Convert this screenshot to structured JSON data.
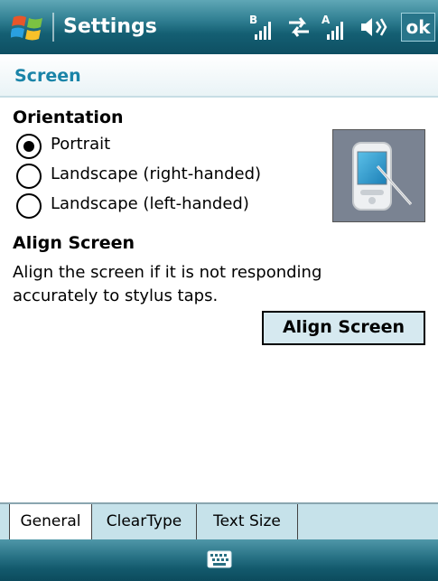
{
  "titlebar": {
    "title": "Settings",
    "ok_label": "ok",
    "status_icons": [
      "bluetooth-signal-icon",
      "data-connection-icon",
      "signal-strength-icon",
      "volume-icon"
    ]
  },
  "header": {
    "title": "Screen"
  },
  "orientation": {
    "heading": "Orientation",
    "options": [
      {
        "label": "Portrait",
        "selected": true
      },
      {
        "label": "Landscape (right-handed)",
        "selected": false
      },
      {
        "label": "Landscape (left-handed)",
        "selected": false
      }
    ],
    "preview_icon": "pda-stylus-icon"
  },
  "align": {
    "heading": "Align Screen",
    "description": "Align the screen if it is not responding accurately to stylus taps.",
    "button_label": "Align Screen"
  },
  "tabs": [
    {
      "label": "General",
      "active": true
    },
    {
      "label": "ClearType",
      "active": false
    },
    {
      "label": "Text Size",
      "active": false
    }
  ],
  "bottombar": {
    "icon": "keyboard-icon"
  },
  "colors": {
    "header_text": "#1a84a8",
    "titlebar": "#145f73",
    "tabstrip": "#c6e2ea",
    "button_bg": "#d6e9f0"
  }
}
